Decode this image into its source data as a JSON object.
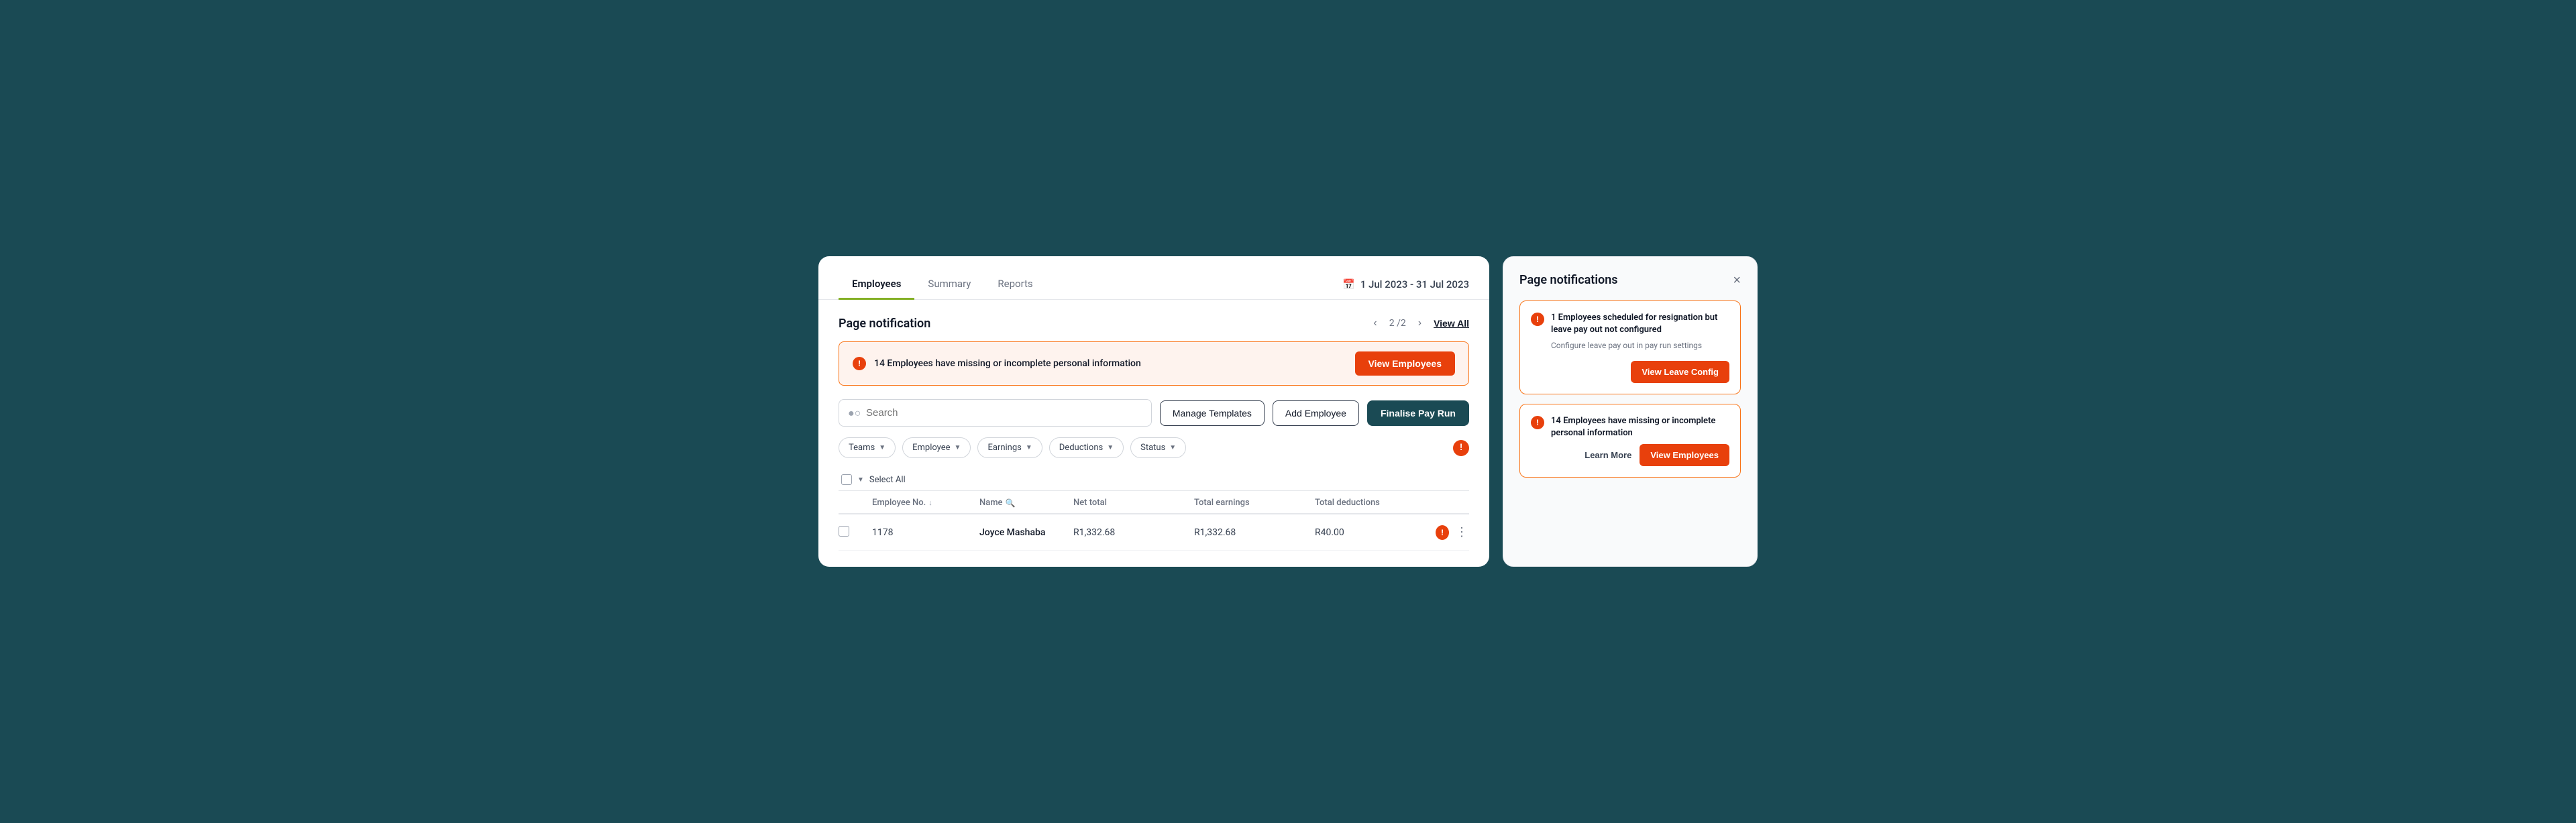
{
  "tabs": {
    "items": [
      {
        "label": "Employees",
        "active": true
      },
      {
        "label": "Summary",
        "active": false
      },
      {
        "label": "Reports",
        "active": false
      }
    ]
  },
  "header": {
    "date_range": "1 Jul 2023  -  31 Jul 2023"
  },
  "page_notification": {
    "title": "Page notification",
    "pagination": "2 /2",
    "view_all": "View All",
    "banner_text": "14 Employees have missing or incomplete personal information",
    "view_employees_label": "View Employees"
  },
  "toolbar": {
    "search_placeholder": "Search",
    "manage_templates_label": "Manage Templates",
    "add_employee_label": "Add Employee",
    "finalise_label": "Finalise Pay Run"
  },
  "filters": {
    "items": [
      {
        "label": "Teams"
      },
      {
        "label": "Employee"
      },
      {
        "label": "Earnings"
      },
      {
        "label": "Deductions"
      },
      {
        "label": "Status"
      }
    ]
  },
  "table": {
    "select_all": "Select All",
    "columns": [
      {
        "label": "Employee No.",
        "sortable": true
      },
      {
        "label": "Name",
        "searchable": true
      },
      {
        "label": "Net total",
        "sortable": false
      },
      {
        "label": "Total earnings",
        "sortable": false
      },
      {
        "label": "Total deductions",
        "sortable": false
      }
    ],
    "rows": [
      {
        "emp_no": "1178",
        "name": "Joyce Mashaba",
        "net_total": "R1,332.68",
        "total_earnings": "R1,332.68",
        "total_deductions": "R40.00",
        "has_warning": true
      }
    ]
  },
  "notifications_panel": {
    "title": "Page notifications",
    "notifications": [
      {
        "id": 1,
        "title": "1 Employees scheduled for resignation but leave pay out not configured",
        "desc": "Configure leave pay out in pay run settings",
        "primary_btn": "View Leave Config",
        "secondary_btn": null
      },
      {
        "id": 2,
        "title": "14 Employees have missing or incomplete personal information",
        "desc": "",
        "primary_btn": "View Employees",
        "secondary_btn": "Learn More"
      }
    ]
  }
}
